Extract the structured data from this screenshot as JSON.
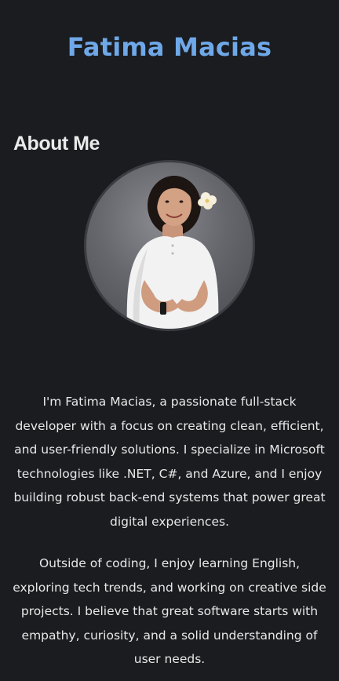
{
  "header": {
    "name": "Fatima Macias"
  },
  "about": {
    "title": "About Me",
    "paragraphs": [
      "I'm Fatima Macias, a passionate full-stack developer with a focus on creating clean, efficient, and user-friendly solutions. I specialize in Microsoft technologies like .NET, C#, and Azure, and I enjoy building robust back-end systems that power great digital experiences.",
      "Outside of coding, I enjoy learning English, exploring tech trends, and working on creative side projects. I believe that great software starts with empathy, curiosity, and a solid understanding of user needs."
    ]
  },
  "colors": {
    "background": "#1b1c20",
    "accent": "#6fa8e8",
    "text": "#e8e8e8"
  }
}
